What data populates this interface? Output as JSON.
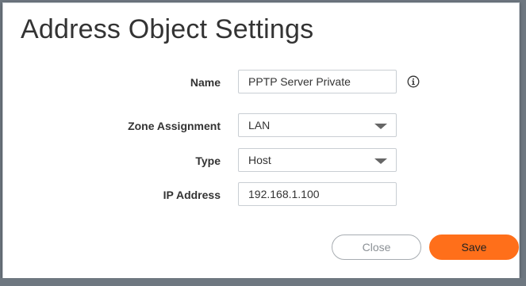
{
  "dialog": {
    "title": "Address Object Settings"
  },
  "form": {
    "name": {
      "label": "Name",
      "value": "PPTP Server Private"
    },
    "zone": {
      "label": "Zone Assignment",
      "value": "LAN"
    },
    "type": {
      "label": "Type",
      "value": "Host"
    },
    "ip": {
      "label": "IP Address",
      "value": "192.168.1.100"
    }
  },
  "buttons": {
    "close_label": "Close",
    "save_label": "Save"
  },
  "colors": {
    "accent": "#ff6f1a",
    "overlay": "#6e7780",
    "border": "#c9ced3"
  },
  "icons": {
    "name_help": "info-icon",
    "dropdown": "chevron-down-icon"
  }
}
